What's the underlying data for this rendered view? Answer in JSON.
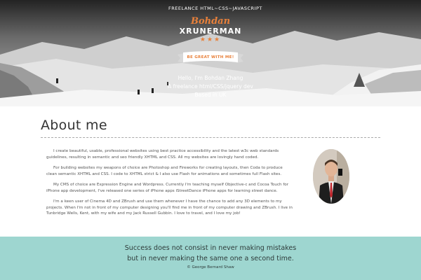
{
  "hero": {
    "tagline": "FREELANCE HTML~CSS~JAVASCRIPT",
    "first_name": "Bohdan",
    "last_name": "XRUNERMAN",
    "stars": "★★★",
    "ribbon": "BE GREAT WITH ME!",
    "intro_lines": [
      "Hello, I'm Bohdan Zhang",
      "A freelance html/CSS/jquery dev",
      "Based in UK"
    ]
  },
  "about": {
    "title": "About me",
    "paragraphs": [
      "I create beautiful, usable, professional websites using best practice accessibility and the latest w3c web standards guidelines, resulting in semantic and seo friendly XHTML and CSS. All my websites are lovingly hand coded.",
      "For building websites my weapons of choice are Photoshop and Fireworks for creating layouts, then Coda to produce clean semantic XHTML and CSS. I code to XHTML strict & I also use Flash for animations and sometimes full Flash sites.",
      "My CMS of choice are Expression Engine and Wordpress. Currently I'm teaching myself Objective-c and Cocoa Touch for iPhone app development, I've released one series of iPhone apps iStreetDance iPhone apps for learning street dance.",
      "I'm a keen user of Cinema 4D and ZBrush and use them whenever I have the chance to add any 3D elements to my projects. When I'm not in front of my computer designing you'll find me in front of my computer drawing and ZBrush. I live in Tunbridge Wells, Kent, with my wife and my Jack Russell Gubbin. I love to travel, and I love my job!"
    ]
  },
  "quote": {
    "line1": "Success does not consist in never making mistakes",
    "line2": "but in never making the same one a second time.",
    "author": "© George Bernard Shaw"
  },
  "colors": {
    "accent": "#e8803a",
    "quote_bg": "#9ed6d0",
    "text": "#555555"
  }
}
